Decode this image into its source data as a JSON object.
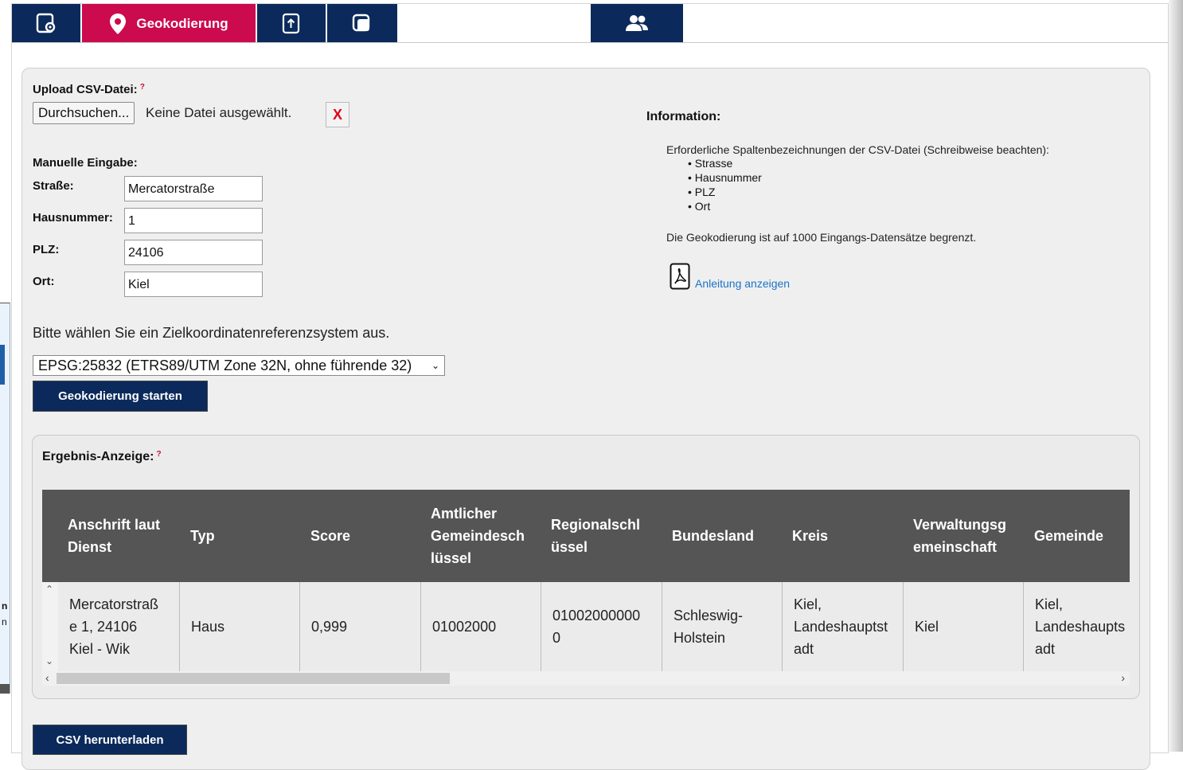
{
  "tabs": [
    {
      "icon": "map-device-icon",
      "label": ""
    },
    {
      "icon": "location-pin-icon",
      "label": "Geokodierung"
    },
    {
      "icon": "file-upload-icon",
      "label": ""
    },
    {
      "icon": "layers-copy-icon",
      "label": ""
    },
    {
      "icon": "users-icon",
      "label": ""
    }
  ],
  "upload": {
    "label": "Upload CSV-Datei:",
    "help": "?",
    "browse_label": "Durchsuchen...",
    "status": "Keine Datei ausgewählt.",
    "clear_label": "X"
  },
  "manual": {
    "heading": "Manuelle Eingabe:",
    "fields": [
      {
        "label": "Straße:",
        "value": "Mercatorstraße"
      },
      {
        "label": "Hausnummer:",
        "value": "1"
      },
      {
        "label": "PLZ:",
        "value": "24106"
      },
      {
        "label": "Ort:",
        "value": "Kiel"
      }
    ]
  },
  "crs": {
    "prompt": "Bitte wählen Sie ein Zielkoordinatenreferenzsystem aus.",
    "selected": "EPSG:25832 (ETRS89/UTM Zone 32N, ohne führende 32)"
  },
  "start_button": "Geokodierung starten",
  "info": {
    "title": "Information:",
    "text1": "Erforderliche Spaltenbezeichnungen der CSV-Datei (Schreibweise beachten):",
    "columns": [
      "Strasse",
      "Hausnummer",
      "PLZ",
      "Ort"
    ],
    "text2": "Die Geokodierung ist auf 1000 Eingangs-Datensätze begrenzt.",
    "link": "Anleitung anzeigen"
  },
  "result": {
    "title": "Ergebnis-Anzeige:",
    "help": "?",
    "headers": [
      [
        "Anschrift laut",
        "Dienst"
      ],
      [
        "Typ"
      ],
      [
        "Score"
      ],
      [
        "Amtlicher",
        "Gemeindesch",
        "lüssel"
      ],
      [
        "Regionalschl",
        "üssel"
      ],
      [
        "Bundesland"
      ],
      [
        "Kreis"
      ],
      [
        "Verwaltungsg",
        "emeinschaft"
      ],
      [
        "Gemeinde"
      ]
    ],
    "row": [
      [
        "Mercatorstraß",
        "e 1, 24106",
        "Kiel - Wik"
      ],
      [
        "Haus"
      ],
      [
        "0,999"
      ],
      [
        "01002000"
      ],
      [
        "01002000000",
        "0"
      ],
      [
        "Schleswig-",
        "Holstein"
      ],
      [
        "Kiel,",
        "Landeshauptst",
        "adt"
      ],
      [
        "Kiel"
      ],
      [
        "Kiel,",
        "Landeshaupts",
        "adt"
      ]
    ]
  },
  "download_button": "CSV herunterladen"
}
